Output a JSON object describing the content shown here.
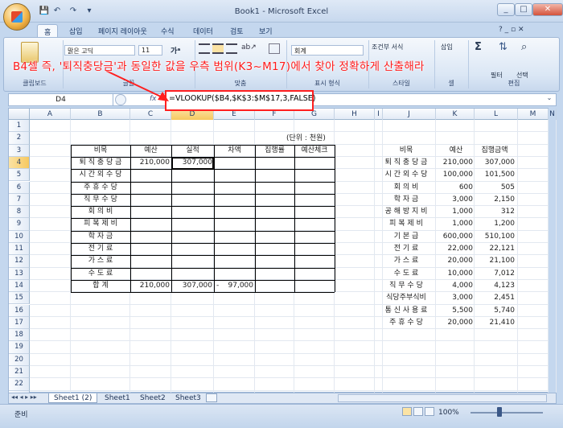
{
  "window": {
    "title": "Book1 - Microsoft Excel",
    "controls": [
      "_",
      "□",
      "✕"
    ]
  },
  "qat": [
    "💾",
    "↶",
    "↷",
    "▾"
  ],
  "ribbon": {
    "tabs": [
      "홈",
      "삽입",
      "페이지 레이아웃",
      "수식",
      "데이터",
      "검토",
      "보기"
    ],
    "font_name": "맑은 고딕",
    "font_size": "11",
    "number_format": "회계",
    "conditional_format": "조건부 서식",
    "insert_label": "삽입",
    "groups": [
      "클립보드",
      "글꼴",
      "맞춤",
      "표시 형식",
      "스타일",
      "셀",
      "편집"
    ],
    "right_small": [
      "필터",
      "선택"
    ],
    "help": "? _ ▫ ✕"
  },
  "annotation": {
    "instruction": "B4셀 즉, '퇴직충당금'과 동일한 값을 우측 범위(K3~M17)에서 찾아 정확하게 산출해라"
  },
  "formula_bar": {
    "name_box": "D4",
    "fx": "fx",
    "formula": "=VLOOKUP($B4,$K$3:$M$17,3,FALSE)"
  },
  "columns": [
    "A",
    "B",
    "C",
    "D",
    "E",
    "F",
    "G",
    "H",
    "I",
    "J",
    "K",
    "L",
    "M",
    "N"
  ],
  "rows": [
    "1",
    "2",
    "3",
    "4",
    "5",
    "6",
    "7",
    "8",
    "9",
    "10",
    "11",
    "12",
    "13",
    "14",
    "15",
    "16",
    "17",
    "18",
    "19",
    "20",
    "21",
    "22",
    "23"
  ],
  "left_table": {
    "unit_note": "(단위 : 천원)",
    "headers": [
      "비목",
      "예산",
      "실적",
      "차액",
      "집행률",
      "예산체크"
    ],
    "rows": [
      {
        "item": "퇴 직 충 당 금",
        "budget": "210,000",
        "actual": "307,000",
        "diff": "",
        "rate": "",
        "check": ""
      },
      {
        "item": "시 간 외 수 당",
        "budget": "",
        "actual": "",
        "diff": "",
        "rate": "",
        "check": ""
      },
      {
        "item": "주   휴   수   당",
        "budget": "",
        "actual": "",
        "diff": "",
        "rate": "",
        "check": ""
      },
      {
        "item": "직   무   수   당",
        "budget": "",
        "actual": "",
        "diff": "",
        "rate": "",
        "check": ""
      },
      {
        "item": "회        의        비",
        "budget": "",
        "actual": "",
        "diff": "",
        "rate": "",
        "check": ""
      },
      {
        "item": "피   복   제   비",
        "budget": "",
        "actual": "",
        "diff": "",
        "rate": "",
        "check": ""
      },
      {
        "item": "학        자        금",
        "budget": "",
        "actual": "",
        "diff": "",
        "rate": "",
        "check": ""
      },
      {
        "item": "전        기        료",
        "budget": "",
        "actual": "",
        "diff": "",
        "rate": "",
        "check": ""
      },
      {
        "item": "가        스        료",
        "budget": "",
        "actual": "",
        "diff": "",
        "rate": "",
        "check": ""
      },
      {
        "item": "수        도        료",
        "budget": "",
        "actual": "",
        "diff": "",
        "rate": "",
        "check": ""
      }
    ],
    "total": {
      "item": "합             계",
      "budget": "210,000",
      "actual": "307,000",
      "diff_sign": "-",
      "diff": "97,000"
    }
  },
  "right_table": {
    "headers": [
      "비목",
      "예산",
      "집행금액"
    ],
    "rows": [
      [
        "퇴 직 충 당 금",
        "210,000",
        "307,000"
      ],
      [
        "시 간 외 수 당",
        "100,000",
        "101,500"
      ],
      [
        "회        의        비",
        "600",
        "505"
      ],
      [
        "학        자        금",
        "3,000",
        "2,150"
      ],
      [
        "공 해 방 지 비",
        "1,000",
        "312"
      ],
      [
        "피   복   제   비",
        "1,000",
        "1,200"
      ],
      [
        "기        본        급",
        "600,000",
        "510,100"
      ],
      [
        "전        기        료",
        "22,000",
        "22,121"
      ],
      [
        "가        스        료",
        "20,000",
        "21,100"
      ],
      [
        "수        도        료",
        "10,000",
        "7,012"
      ],
      [
        "직   무   수   당",
        "4,000",
        "4,123"
      ],
      [
        "식당주부식비",
        "3,000",
        "2,451"
      ],
      [
        "통 신 사 용 료",
        "5,500",
        "5,740"
      ],
      [
        "주   휴   수   당",
        "20,000",
        "21,410"
      ]
    ]
  },
  "sheet_tabs": [
    "Sheet1 (2)",
    "Sheet1",
    "Sheet2",
    "Sheet3"
  ],
  "status": {
    "ready": "준비",
    "zoom": "100%"
  }
}
